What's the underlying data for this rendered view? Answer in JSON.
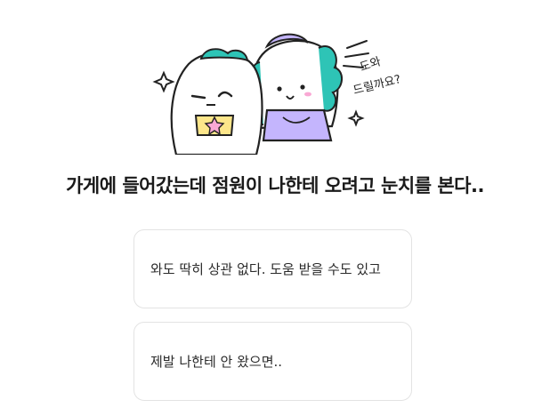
{
  "illustration": {
    "speech_text_line1": "도와",
    "speech_text_line2": "드릴까요?"
  },
  "question": {
    "text": "가게에 들어갔는데 점원이 나한테 오려고 눈치를 본다.."
  },
  "options": [
    {
      "label": "와도 딱히 상관 없다. 도움 받을 수도 있고"
    },
    {
      "label": "제발 나한테 안 왔으면.."
    }
  ],
  "colors": {
    "mint_hair": "#2ec4b6",
    "purple_apron": "#c4b5fd",
    "shirt_yellow": "#fde68a",
    "star_pink": "#f9a8d4",
    "option_border": "#e3e3e3"
  }
}
